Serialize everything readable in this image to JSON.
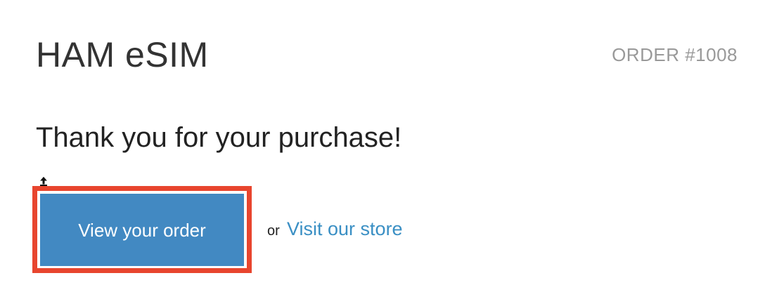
{
  "header": {
    "shop_name": "HAM eSIM",
    "order_number": "ORDER #1008"
  },
  "main": {
    "heading": "Thank you for your purchase!",
    "view_order_label": "View your order",
    "or_text": "or",
    "visit_store_label": "Visit our store"
  },
  "colors": {
    "button_background": "#4289c2",
    "link": "#3a8fc4",
    "highlight_border": "#e8452e"
  },
  "icons": {
    "cursor": "mouse-cursor-icon"
  }
}
